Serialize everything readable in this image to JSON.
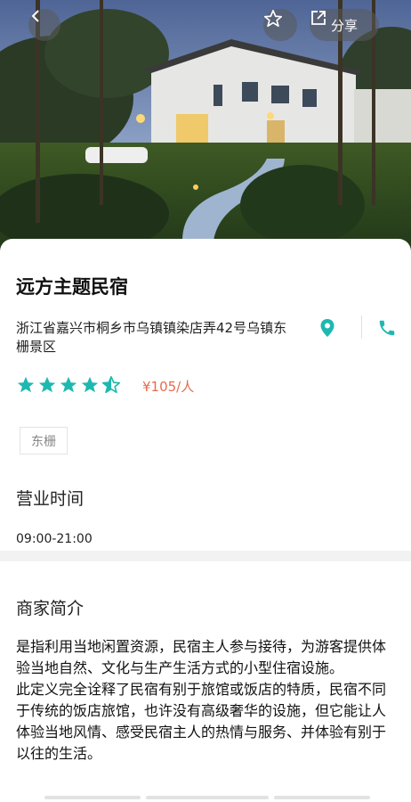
{
  "header": {
    "back_icon": "chevron-left-icon",
    "favorite_icon": "star-outline-icon",
    "share_icon": "share-icon",
    "share_label": "分享"
  },
  "shop": {
    "name": "远方主题民宿",
    "address": "浙江省嘉兴市桐乡市乌镇镇染店弄42号乌镇东栅景区",
    "rating": 4.5,
    "price": "¥105/人",
    "tag": "东栅"
  },
  "hours": {
    "title": "营业时间",
    "value": "09:00-21:00"
  },
  "intro": {
    "title": "商家简介",
    "paragraph1": "是指利用当地闲置资源，民宿主人参与接待，为游客提供体验当地自然、文化与生产生活方式的小型住宿设施。",
    "paragraph2": "此定义完全诠释了民宿有别于旅馆或饭店的特质，民宿不同于传统的饭店旅馆，也许没有高级奢华的设施，但它能让人体验当地风情、感受民宿主人的热情与服务、并体验有别于以往的生活。"
  },
  "colors": {
    "accent": "#1fb8b0",
    "price": "#e86a4e"
  }
}
